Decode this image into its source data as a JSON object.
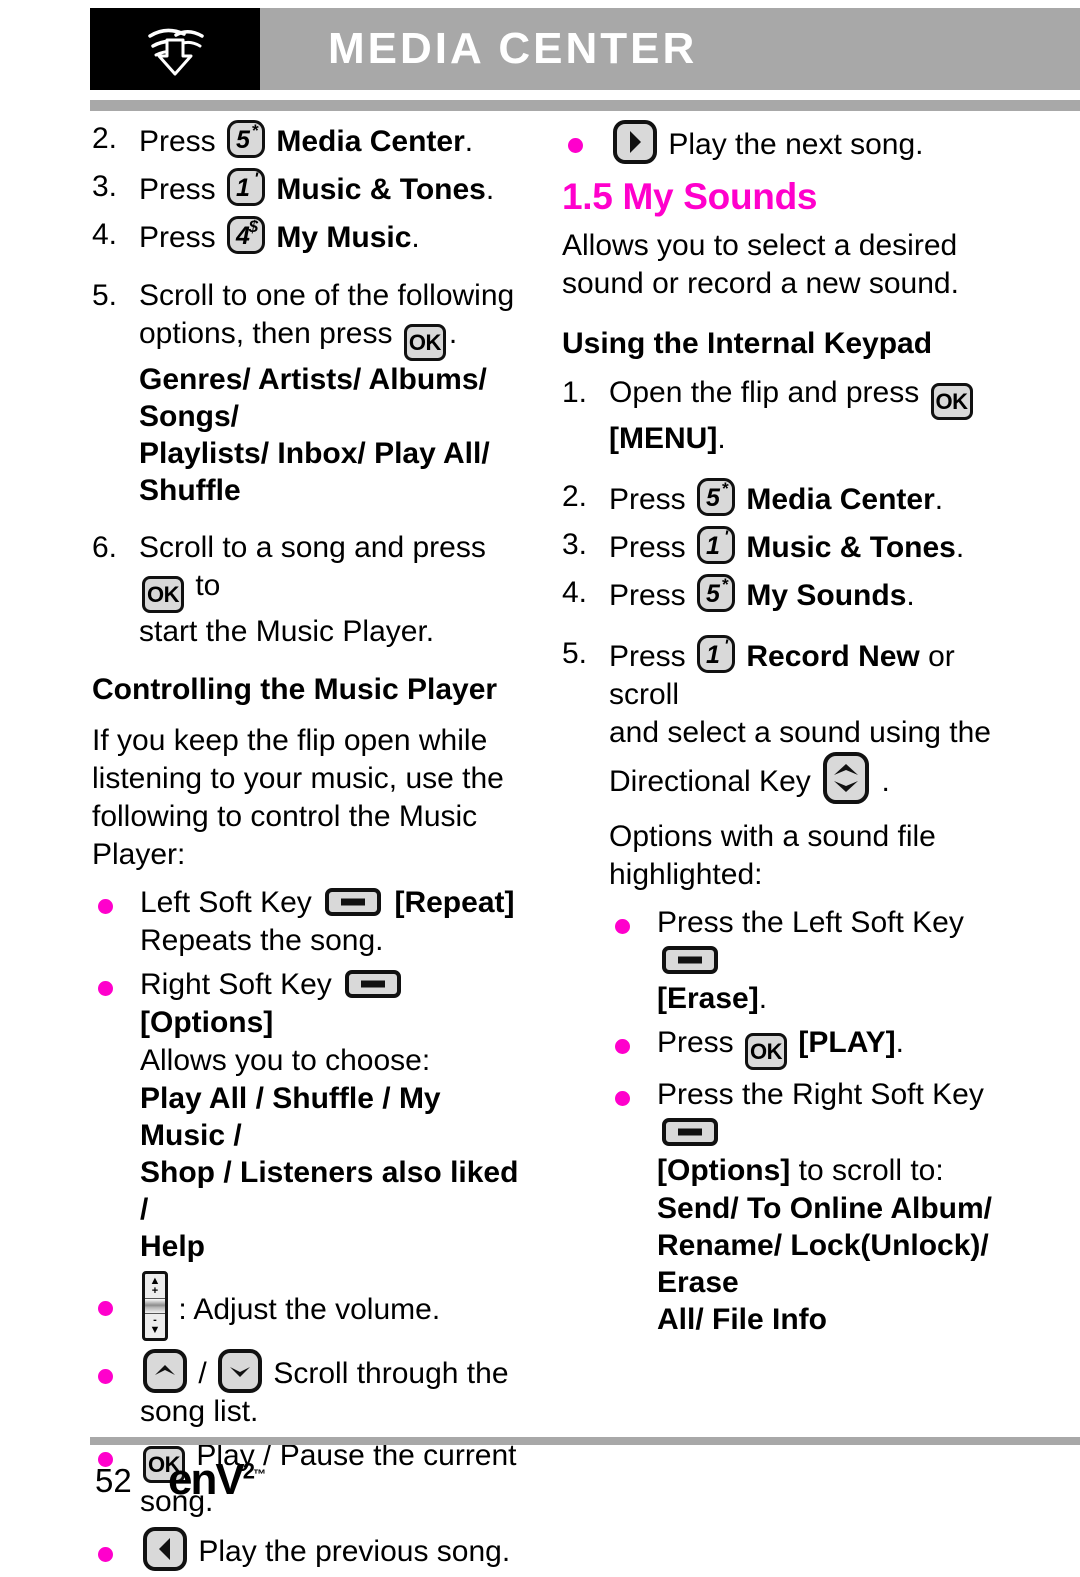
{
  "header": {
    "title": "MEDIA CENTER",
    "icon": "download-arrow-icon",
    "bar_color": "#a8a8a8",
    "title_color": "#ffffff"
  },
  "theme": {
    "accent": "#ff00cc",
    "rule": "#a8a8a8",
    "key_fill": "#d9d9d9",
    "key_border": "#111111"
  },
  "left_column": {
    "steps": [
      {
        "num": "2.",
        "pre": "Press",
        "key": "5",
        "key_sup": "*",
        "bold": "Media Center",
        "post": "."
      },
      {
        "num": "3.",
        "pre": "Press",
        "key": "1",
        "key_sup": "'",
        "bold": "Music & Tones",
        "post": "."
      },
      {
        "num": "4.",
        "pre": "Press",
        "key": "4",
        "key_sup": "$",
        "bold": "My Music",
        "post": "."
      }
    ],
    "step5": {
      "num": "5.",
      "line1": "Scroll to one of the following",
      "line2a": "options, then press",
      "ok_label": "OK",
      "line2b": ".",
      "options_line1": "Genres/ Artists/ Albums/ Songs/",
      "options_line2": "Playlists/ Inbox/ Play All/ Shuffle"
    },
    "step6": {
      "num": "6.",
      "line1a": "Scroll to a song and press",
      "ok_label": "OK",
      "line1b": "to",
      "line2": "start the Music Player."
    },
    "section_heading": "Controlling the Music Player",
    "intro_paragraph": "If you keep the flip open while listening to your music, use the following to control the Music Player:",
    "bullets": {
      "left_soft": {
        "label": "Left Soft Key",
        "icon": "soft-key-icon",
        "bracket": "[Repeat]",
        "desc": "Repeats the song."
      },
      "right_soft": {
        "label": "Right Soft Key",
        "icon": "soft-key-icon",
        "bracket": "[Options]",
        "desc": "Allows you to choose:",
        "options_line1": "Play All / Shuffle / My Music /",
        "options_line2": "Shop / Listeners also liked /",
        "options_line3": "Help"
      },
      "volume": {
        "icon": "volume-rocker-icon",
        "text": ": Adjust the volume.",
        "plus": "+",
        "minus": "-"
      },
      "scroll": {
        "icon_up": "arrow-up-key-icon",
        "separator": "/",
        "icon_down": "arrow-down-key-icon",
        "text": "Scroll through the song list."
      },
      "play_pause": {
        "ok_label": "OK",
        "text": "Play / Pause the current song."
      },
      "previous": {
        "icon": "arrow-left-key-icon",
        "text": "Play the previous song."
      }
    }
  },
  "right_column": {
    "next_song": {
      "icon": "arrow-right-key-icon",
      "text": "Play the next song."
    },
    "heading": "1.5 My Sounds",
    "description": "Allows you to select a desired sound or record a new sound.",
    "sub_heading": "Using the Internal Keypad",
    "steps": {
      "s1": {
        "num": "1.",
        "line1a": "Open the flip and press",
        "ok_label": "OK",
        "line2_bold": "[MENU]",
        "line2_post": "."
      },
      "s2": {
        "num": "2.",
        "pre": "Press",
        "key": "5",
        "key_sup": "*",
        "bold": "Media Center",
        "post": "."
      },
      "s3": {
        "num": "3.",
        "pre": "Press",
        "key": "1",
        "key_sup": "'",
        "bold": "Music & Tones",
        "post": "."
      },
      "s4": {
        "num": "4.",
        "pre": "Press",
        "key": "5",
        "key_sup": "*",
        "bold": "My Sounds",
        "post": "."
      },
      "s5": {
        "num": "5.",
        "pre": "Press",
        "key": "1",
        "key_sup": "'",
        "bold": "Record New",
        "post": "or scroll",
        "line2": "and select a sound using the",
        "line3a": "Directional Key",
        "dir_icon": "directional-key-icon",
        "line3b": "."
      }
    },
    "options_intro": "Options with a sound file highlighted:",
    "option_bullets": {
      "erase": {
        "text": "Press the Left Soft Key",
        "icon": "soft-key-icon",
        "bracket": "[Erase]",
        "post": "."
      },
      "play": {
        "pre": "Press",
        "ok_label": "OK",
        "bracket": "[PLAY]",
        "post": "."
      },
      "options": {
        "text": "Press the Right Soft Key",
        "icon": "soft-key-icon",
        "bracket": "[Options]",
        "post": "to scroll to:",
        "list_line1": "Send/ To Online Album/",
        "list_line2": "Rename/ Lock(Unlock)/ Erase",
        "list_line3": "All/ File Info"
      }
    }
  },
  "footer": {
    "page_number": "52",
    "logo_main": "enV",
    "logo_sup": "2",
    "logo_tm": "™"
  }
}
